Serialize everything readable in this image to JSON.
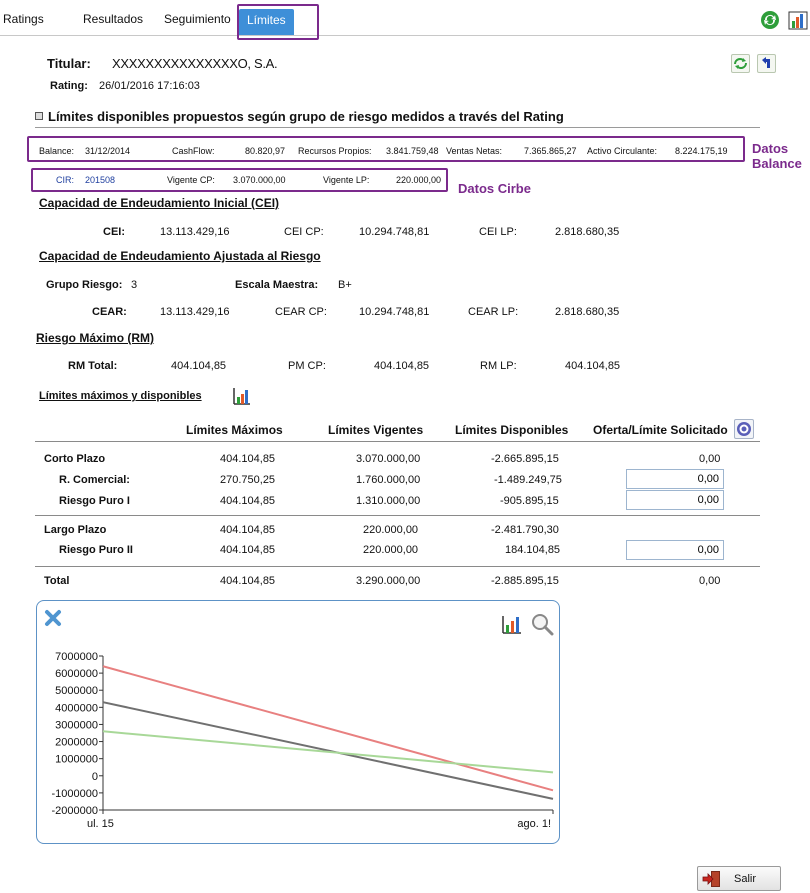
{
  "tabs": [
    {
      "label": "Ratings"
    },
    {
      "label": "Resultados"
    },
    {
      "label": "Seguimiento"
    },
    {
      "label": "Límites"
    }
  ],
  "header": {
    "titular_label": "Titular:",
    "titular_value": "XXXXXXXXXXXXXXXO, S.A.",
    "rating_label": "Rating:",
    "rating_value": "26/01/2016 17:16:03"
  },
  "section_title": "Límites disponibles propuestos según grupo de riesgo medidos a través del Rating",
  "balance": {
    "balance_label": "Balance:",
    "balance_value": "31/12/2014",
    "cashflow_label": "CashFlow:",
    "cashflow_value": "80.820,97",
    "rp_label": "Recursos Propios:",
    "rp_value": "3.841.759,48",
    "vn_label": "Ventas Netas:",
    "vn_value": "7.365.865,27",
    "ac_label": "Activo Circulante:",
    "ac_value": "8.224.175,19"
  },
  "annotations": {
    "balance_line1": "Datos",
    "balance_line2": "Balance",
    "cirbe": "Datos Cirbe"
  },
  "cirbe": {
    "cir_label": "CIR:",
    "cir_value": "201508",
    "vcp_label": "Vigente CP:",
    "vcp_value": "3.070.000,00",
    "vlp_label": "Vigente LP:",
    "vlp_value": "220.000,00"
  },
  "cei": {
    "title": "Capacidad de Endeudamiento Inicial (CEI)",
    "cei_label": "CEI:",
    "cei_value": "13.113.429,16",
    "cp_label": "CEI CP:",
    "cp_value": "10.294.748,81",
    "lp_label": "CEI LP:",
    "lp_value": "2.818.680,35"
  },
  "cear": {
    "title": "Capacidad de Endeudamiento Ajustada al Riesgo",
    "grupo_label": "Grupo Riesgo:",
    "grupo_value": "3",
    "escala_label": "Escala Maestra:",
    "escala_value": "B+",
    "cear_label": "CEAR:",
    "cear_value": "13.113.429,16",
    "cp_label": "CEAR CP:",
    "cp_value": "10.294.748,81",
    "lp_label": "CEAR LP:",
    "lp_value": "2.818.680,35"
  },
  "rm": {
    "title": "Riesgo Máximo (RM)",
    "total_label": "RM Total:",
    "total_value": "404.104,85",
    "cp_label": "PM CP:",
    "cp_value": "404.104,85",
    "lp_label": "RM LP:",
    "lp_value": "404.104,85"
  },
  "limits": {
    "title": "Límites máximos y disponibles",
    "headers": [
      "Límites Máximos",
      "Límites Vigentes",
      "Límites Disponibles",
      "Oferta/Límite Solicitado"
    ],
    "rows": [
      {
        "label": "Corto Plazo",
        "max": "404.104,85",
        "vig": "3.070.000,00",
        "disp": "-2.665.895,15",
        "oferta": "0,00"
      },
      {
        "label": "R. Comercial:",
        "max": "270.750,25",
        "vig": "1.760.000,00",
        "disp": "-1.489.249,75",
        "oferta": "0,00"
      },
      {
        "label": "Riesgo Puro I",
        "max": "404.104,85",
        "vig": "1.310.000,00",
        "disp": "-905.895,15",
        "oferta": "0,00"
      },
      {
        "label": "Largo Plazo",
        "max": "404.104,85",
        "vig": "220.000,00",
        "disp": "-2.481.790,30",
        "oferta": ""
      },
      {
        "label": "Riesgo Puro II",
        "max": "404.104,85",
        "vig": "220.000,00",
        "disp": "184.104,85",
        "oferta": "0,00"
      },
      {
        "label": "Total",
        "max": "404.104,85",
        "vig": "3.290.000,00",
        "disp": "-2.885.895,15",
        "oferta": "0,00"
      }
    ]
  },
  "chart_data": {
    "type": "line",
    "x": [
      "ul. 15",
      "ago. 15"
    ],
    "ylim": [
      -2000000,
      7000000
    ],
    "yticks": [
      7000000,
      6000000,
      5000000,
      4000000,
      3000000,
      2000000,
      1000000,
      0,
      -1000000,
      -2000000
    ],
    "xticks": [
      "ul. 15",
      "ago. 1!"
    ],
    "series": [
      {
        "values": [
          6400000,
          -850000
        ],
        "color": "#e88080"
      },
      {
        "values": [
          4300000,
          -1350000
        ],
        "color": "#707070"
      },
      {
        "values": [
          2600000,
          200000
        ],
        "color": "#a8d898"
      }
    ]
  },
  "footer": {
    "salir_label": "Salir"
  },
  "colors": {
    "active_tab": "#3e8fd8",
    "annotation": "#7b2a8c",
    "chart_border": "#5d92c6",
    "link_blue": "#1f3f9f"
  }
}
